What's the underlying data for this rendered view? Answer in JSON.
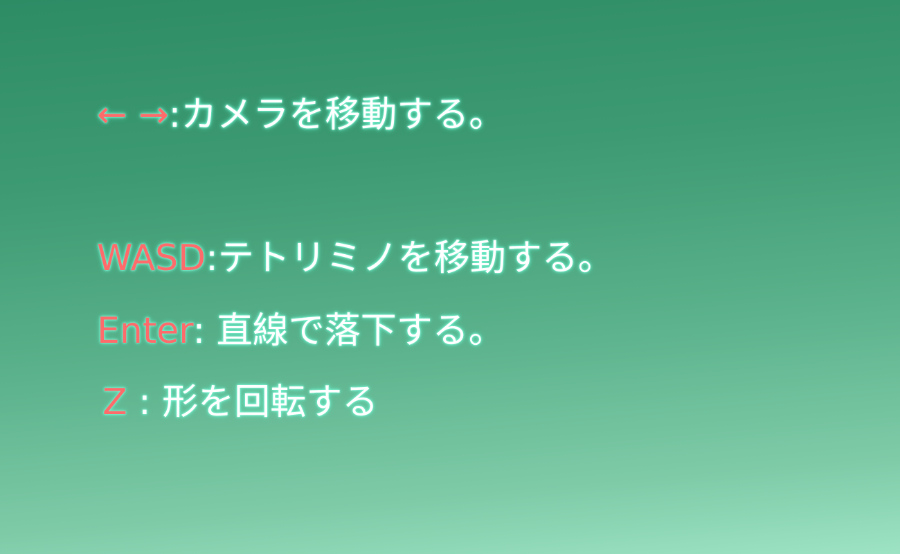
{
  "controls": [
    {
      "key": "← →",
      "separator": ":",
      "action": "カメラを移動する。"
    },
    {
      "key": "WASD",
      "separator": ":",
      "action": "テトリミノを移動する。"
    },
    {
      "key": "Enter",
      "separator": ": ",
      "action": "直線で落下する。"
    },
    {
      "key": "Z",
      "separator": " : ",
      "action": "形を回転する"
    }
  ],
  "colors": {
    "key": "#ff6b6b",
    "text": "#ffffff",
    "glow": "#58e6bd",
    "background_top": "#2e8c65",
    "background_bottom": "#9de3c4"
  }
}
